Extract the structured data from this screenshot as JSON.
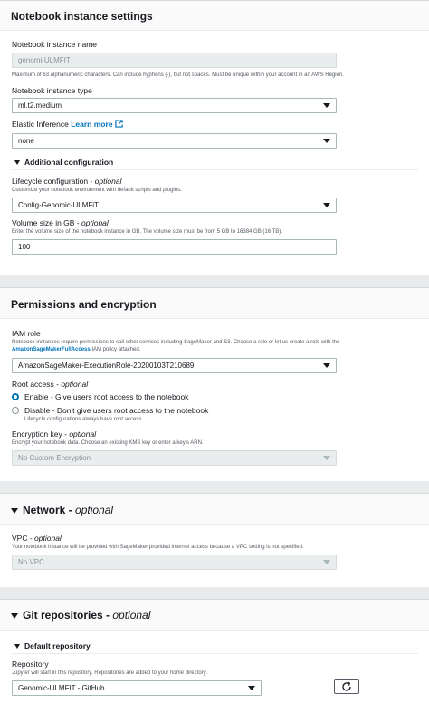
{
  "notebook": {
    "title": "Notebook instance settings",
    "name_label": "Notebook instance name",
    "name_value": "genomi-ULMFIT",
    "name_hint": "Maximum of 63 alphanumeric characters. Can include hyphens (-), but not spaces. Must be unique within your account in an AWS Region.",
    "type_label": "Notebook instance type",
    "type_value": "ml.t2.medium",
    "ei_label": "Elastic Inference",
    "ei_link": "Learn more",
    "ei_value": "none",
    "additional_config": "Additional configuration",
    "lifecycle_label": "Lifecycle configuration - ",
    "lifecycle_optional": "optional",
    "lifecycle_desc": "Customize your notebook environment with default scripts and plugins.",
    "lifecycle_value": "Config-Genomic-ULMFiT",
    "volume_label": "Volume size in GB - ",
    "volume_optional": "optional",
    "volume_desc": "Enter the volume size of the notebook instance in GB. The volume size must be from 5 GB to 16384 GB (16 TB).",
    "volume_value": "100"
  },
  "permissions": {
    "title": "Permissions and encryption",
    "iam_label": "IAM role",
    "iam_desc_1": "Notebook instances require permissions to call other services including SageMaker and S3. Choose a role or let us create a role with the",
    "iam_desc_policy": "AmazonSageMakerFullAccess",
    "iam_desc_2": " IAM policy attached.",
    "iam_value": "AmazonSageMaker-ExecutionRole-20200103T210689",
    "root_label": "Root access - ",
    "root_optional": "optional",
    "root_enable": "Enable - Give users root access to the notebook",
    "root_disable": "Disable - Don't give users root access to the notebook",
    "root_disable_desc": "Lifecycle configurations always have root access",
    "enc_label": "Encryption key - ",
    "enc_optional": "optional",
    "enc_desc": "Encrypt your notebook data. Choose an existing KMS key or enter a key's ARN.",
    "enc_value": "No Custom Encryption"
  },
  "network": {
    "title": "Network - ",
    "title_optional": "optional",
    "vpc_label": "VPC - ",
    "vpc_optional": "optional",
    "vpc_desc": "Your notebook instance will be provided with SageMaker provided internet access because a VPC setting is not specified.",
    "vpc_value": "No VPC"
  },
  "git": {
    "title": "Git repositories - ",
    "title_optional": "optional",
    "default_repo": "Default repository",
    "repo_label": "Repository",
    "repo_desc": "Jupyter will start in this repository. Repositories are added to your home directory.",
    "repo_value": "Genomic-ULMFIT - GitHub"
  },
  "icons": [
    "external-link-icon",
    "caret-down-icon",
    "expand-triangle-icon",
    "refresh-icon"
  ],
  "colors": {
    "link": "#0073bb",
    "radio_selected": "#0073bb",
    "background": "#e9ebed"
  }
}
